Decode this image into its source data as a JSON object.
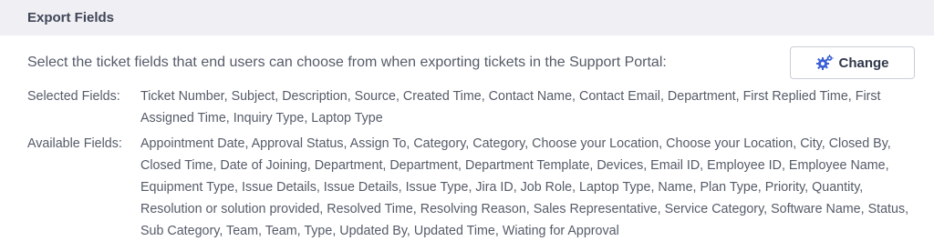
{
  "header": {
    "title": "Export Fields"
  },
  "main": {
    "description": "Select the ticket fields that end users can choose from when exporting tickets in the Support Portal:",
    "change_button": {
      "label": "Change",
      "icon": "gears-icon",
      "icon_color": "#3a5fd6"
    },
    "selected_fields": {
      "label": "Selected Fields:",
      "value": "Ticket Number, Subject, Description, Source, Created Time, Contact Name, Contact Email, Department, First Replied Time, First Assigned Time, Inquiry Type, Laptop Type"
    },
    "available_fields": {
      "label": "Available Fields:",
      "value": "Appointment Date, Approval Status, Assign To, Category, Category, Choose your Location, Choose your Location, City, Closed By, Closed Time, Date of Joining, Department, Department, Department Template, Devices, Email ID, Employee ID, Employee Name, Equipment Type, Issue Details, Issue Details, Issue Type, Jira ID, Job Role, Laptop Type, Name, Plan Type, Priority, Quantity, Resolution or solution provided, Resolved Time, Resolving Reason, Sales Representative, Service Category, Software Name, Status, Sub Category, Team, Team, Type, Updated By, Updated Time, Wiating for Approval"
    }
  }
}
